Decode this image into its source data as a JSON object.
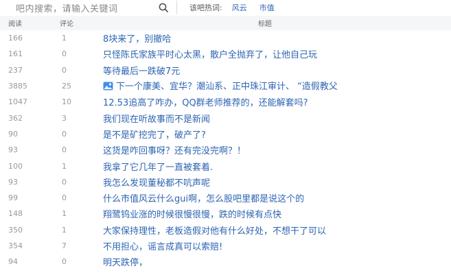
{
  "search": {
    "placeholder": "吧内搜索，请输入关键词"
  },
  "hot": {
    "label": "该吧热词:",
    "words": [
      "风云",
      "市值"
    ]
  },
  "table": {
    "headers": {
      "read": "阅读",
      "reply": "评论",
      "title": "标题"
    },
    "rows": [
      {
        "read": "166",
        "reply": "1",
        "title": "8块来了，别撤哈"
      },
      {
        "read": "161",
        "reply": "0",
        "title": "只怪陈氏家族平时心太黑，散户全抛弃了，让他自己玩"
      },
      {
        "read": "237",
        "reply": "0",
        "title": "等待最后一跌破7元"
      },
      {
        "read": "3885",
        "reply": "25",
        "title": "下一个康美、宜华？潮汕系、正中珠江审计、 “造假教父",
        "has_image": true
      },
      {
        "read": "1047",
        "reply": "10",
        "title": "12.53追高了咋办，QQ群老师推荐的，还能解套吗?"
      },
      {
        "read": "362",
        "reply": "3",
        "title": "我们现在听故事而不是新闻"
      },
      {
        "read": "90",
        "reply": "0",
        "title": "是不是矿挖完了，破产了?"
      },
      {
        "read": "93",
        "reply": "0",
        "title": "这货是咋回事呀？还有完没完啊？！"
      },
      {
        "read": "100",
        "reply": "1",
        "title": "我拿了它几年了一直被套着."
      },
      {
        "read": "93",
        "reply": "0",
        "title": "我怎么发现董秘都不吭声呢"
      },
      {
        "read": "99",
        "reply": "0",
        "title": "什么市值风云什么gui啊，怎么股吧里都是说这个的"
      },
      {
        "read": "148",
        "reply": "1",
        "title": "翔鹭钨业涨的时候很慢很慢，跌的时候有点快"
      },
      {
        "read": "350",
        "reply": "1",
        "title": "大家保持理性，老板造假对他有什么好处，不想干了可以"
      },
      {
        "read": "354",
        "reply": "7",
        "title": "不用担心，谣言成真可以索赔!"
      },
      {
        "read": "94",
        "reply": "0",
        "title": "明天跌停，"
      }
    ]
  }
}
